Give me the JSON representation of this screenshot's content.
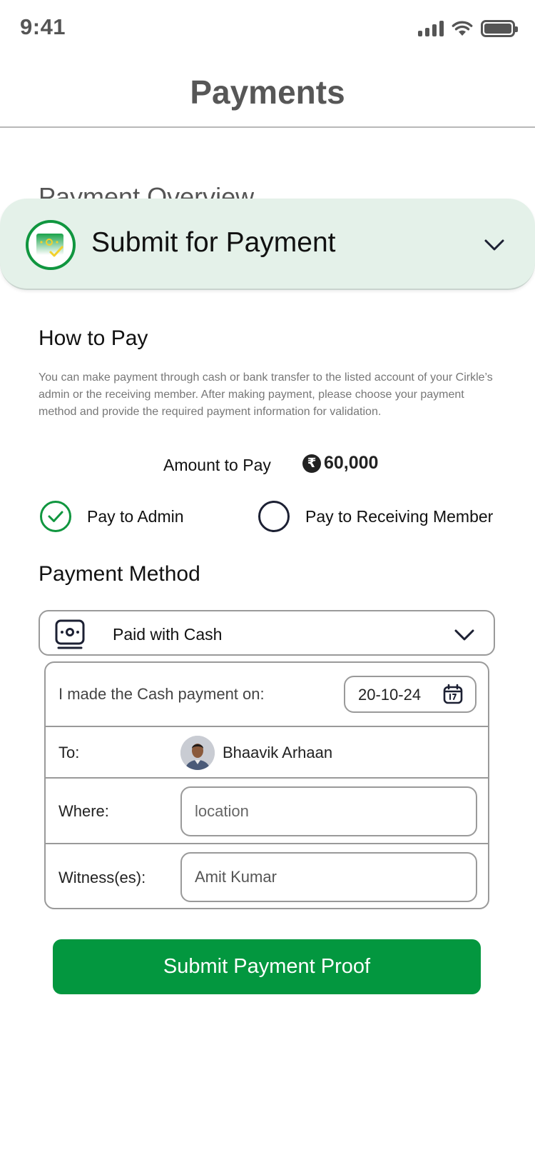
{
  "status_bar": {
    "time": "9:41",
    "icons": [
      "cellular-signal-icon",
      "wifi-icon",
      "battery-icon"
    ]
  },
  "header": {
    "title": "Payments"
  },
  "overview": {
    "peek_title": "Payment Overview"
  },
  "submit_card": {
    "icon": "cash-check-icon",
    "title": "Submit for Payment",
    "chevron": "chevron-down-icon"
  },
  "how_to_pay": {
    "title": "How to Pay",
    "description": "You can make payment through cash or bank transfer to the listed account of your Cirkle’s admin or the receiving member. After making payment, please choose your payment method and provide the required payment information for validation."
  },
  "amount": {
    "label": "Amount to Pay",
    "currency_symbol": "₹",
    "value": "60,000"
  },
  "pay_to": {
    "options": [
      {
        "label": "Pay to Admin",
        "selected": true
      },
      {
        "label": "Pay to Receiving Member",
        "selected": false
      }
    ]
  },
  "payment_method": {
    "title": "Payment Method",
    "selected": "Paid with Cash",
    "icon": "cash-icon"
  },
  "details": {
    "date_label": "I made the Cash payment on:",
    "date_value": "20-10-24",
    "to_label": "To:",
    "to_name": "Bhaavik Arhaan",
    "where_label": "Where:",
    "where_placeholder": "location",
    "witness_label": "Witness(es):",
    "witness_value": "Amit Kumar"
  },
  "submit_button": {
    "label": "Submit Payment Proof"
  },
  "colors": {
    "accent_green": "#03973f",
    "card_background": "#e4f1e9",
    "border_gray": "#9a9a9a",
    "title_gray": "#575757"
  }
}
